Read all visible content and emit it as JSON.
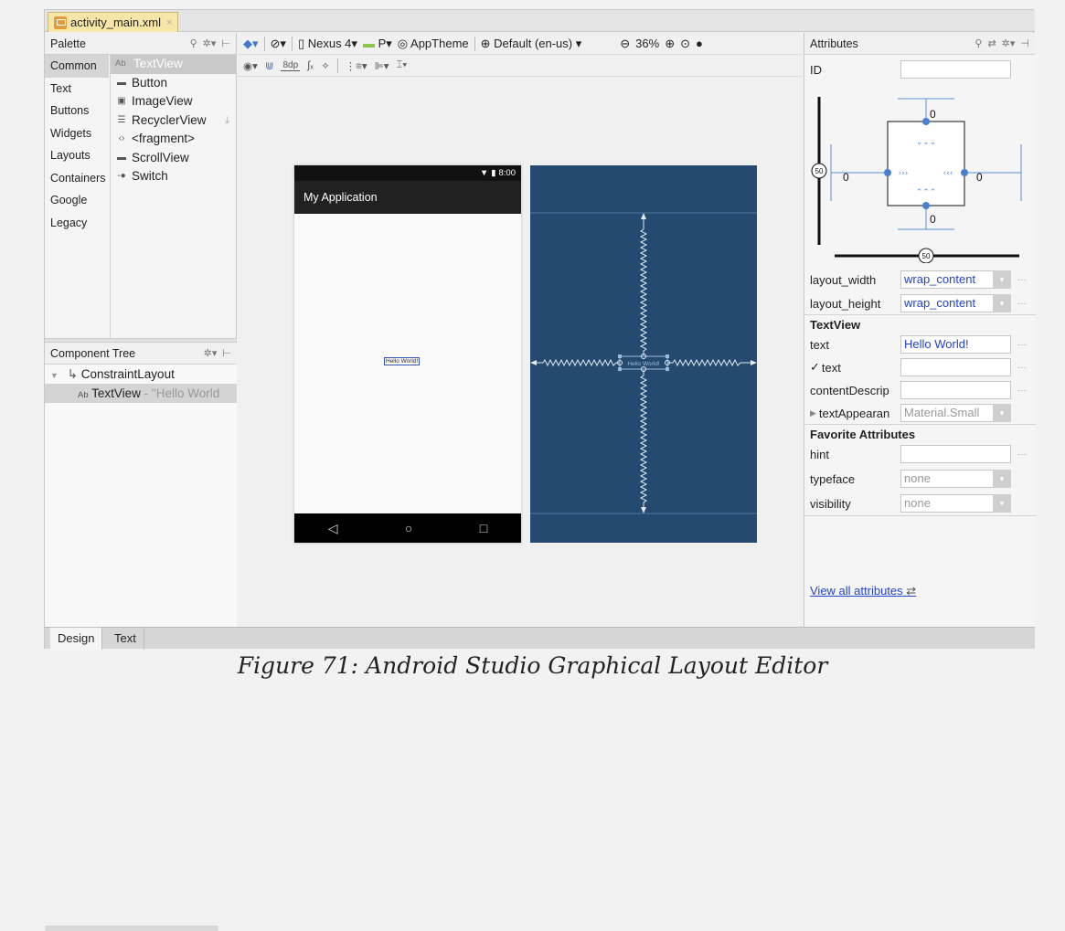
{
  "file_tab": {
    "name": "activity_main.xml",
    "close": "×"
  },
  "palette": {
    "title": "Palette",
    "categories": [
      "Common",
      "Text",
      "Buttons",
      "Widgets",
      "Layouts",
      "Containers",
      "Google",
      "Legacy"
    ],
    "selected_category": "Common",
    "items": [
      {
        "label": "TextView",
        "icon": "Ab"
      },
      {
        "label": "Button",
        "icon": "button-icon"
      },
      {
        "label": "ImageView",
        "icon": "image-icon"
      },
      {
        "label": "RecyclerView",
        "icon": "list-icon"
      },
      {
        "label": "<fragment>",
        "icon": "fragment-icon"
      },
      {
        "label": "ScrollView",
        "icon": "scroll-icon"
      },
      {
        "label": "Switch",
        "icon": "switch-icon"
      }
    ]
  },
  "component_tree": {
    "title": "Component Tree",
    "root": "ConstraintLayout",
    "child_icon": "Ab",
    "child": "TextView",
    "child_hint": " - \"Hello World"
  },
  "toolbar": {
    "device": "Nexus 4",
    "api": "P",
    "theme": "AppTheme",
    "locale": "Default (en-us)",
    "zoom": "36%",
    "margin": "8dp"
  },
  "preview": {
    "time": "8:00",
    "app_title": "My Application",
    "hello": "Hello World!"
  },
  "attributes": {
    "title": "Attributes",
    "id_label": "ID",
    "constraints": {
      "top": "0",
      "left": "0",
      "right": "0",
      "bottom": "0",
      "vbias": "50",
      "hbias": "50"
    },
    "layout_width_label": "layout_width",
    "layout_width": "wrap_content",
    "layout_height_label": "layout_height",
    "layout_height": "wrap_content",
    "section_textview": "TextView",
    "text_label": "text",
    "text_value": "Hello World!",
    "tools_text_label": "text",
    "content_desc_label": "contentDescrip",
    "text_appearance_label": "textAppearan",
    "text_appearance_value": "Material.Small",
    "section_favorites": "Favorite Attributes",
    "hint_label": "hint",
    "typeface_label": "typeface",
    "typeface_value": "none",
    "visibility_label": "visibility",
    "visibility_value": "none",
    "view_all": "View all attributes"
  },
  "bottom_tabs": [
    "Design",
    "Text"
  ],
  "caption": "Figure 71: Android Studio Graphical Layout Editor"
}
